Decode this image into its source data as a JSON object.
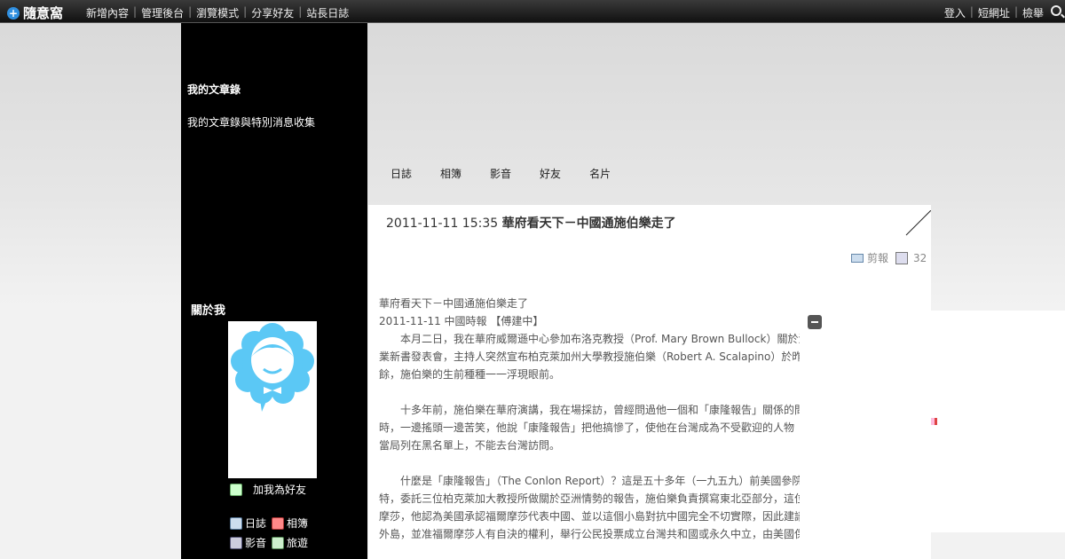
{
  "topbar": {
    "logo": "隨意窩",
    "nav": [
      "新增內容",
      "管理後台",
      "瀏覽模式",
      "分享好友",
      "站長日誌"
    ],
    "right_nav": [
      "登入",
      "短網址",
      "檢舉"
    ]
  },
  "sidebar": {
    "blog_title": "我的文章錄",
    "blog_desc": "我的文章錄與特別消息收集",
    "about_title": "關於我",
    "add_friend": "加我為好友",
    "links": [
      "日誌",
      "相簿",
      "影音",
      "旅遊"
    ]
  },
  "main_nav": [
    "日誌",
    "相簿",
    "影音",
    "好友",
    "名片"
  ],
  "post": {
    "date": "2011-11-11 15:35",
    "title": "華府看天下－中國通施伯樂走了",
    "category": "剪報",
    "views": "32",
    "lines": [
      "華府看天下－中國通施伯樂走了",
      "2011-11-11 中國時報 【傅建中】",
      "　　本月二日，我在華府威爾遜中心參加布洛克教授（Prof. Mary Brown Bullock）關於洛克",
      "業新書發表會，主持人突然宣布柏克萊加州大學教授施伯樂（Robert A. Scalapino）於昨夜",
      "餘，施伯樂的生前種種一一浮現眼前。",
      "",
      "　　十多年前，施伯樂在華府演講，我在場採訪，曾經問過他一個和「康隆報告」關係的問",
      "時，一邊搖頭一邊苦笑，他說「康隆報告」把他搞慘了，使他在台灣成為不受歡迎的人物",
      "當局列在黑名單上，不能去台灣訪問。",
      "",
      "　　什麼是「康隆報告」（The Conlon Report）？這是五十多年（一九五九）前美國參院",
      "特，委託三位柏克萊加大教授所做關於亞洲情勢的報告，施伯樂負責撰寫東北亞部分，這位",
      "摩莎，他認為美國承認福爾摩莎代表中國、並以這個小島對抗中國完全不切實際，因此建議",
      "外島，並准福爾摩莎人有自決的權利，舉行公民投票成立台灣共和國或永久中立，由美國保障其安全。"
    ]
  },
  "colors": {
    "sidebar_bg": "#000000",
    "avatar_cloud": "#5bc8f5",
    "topbar_bg": "#1a1a1a"
  }
}
